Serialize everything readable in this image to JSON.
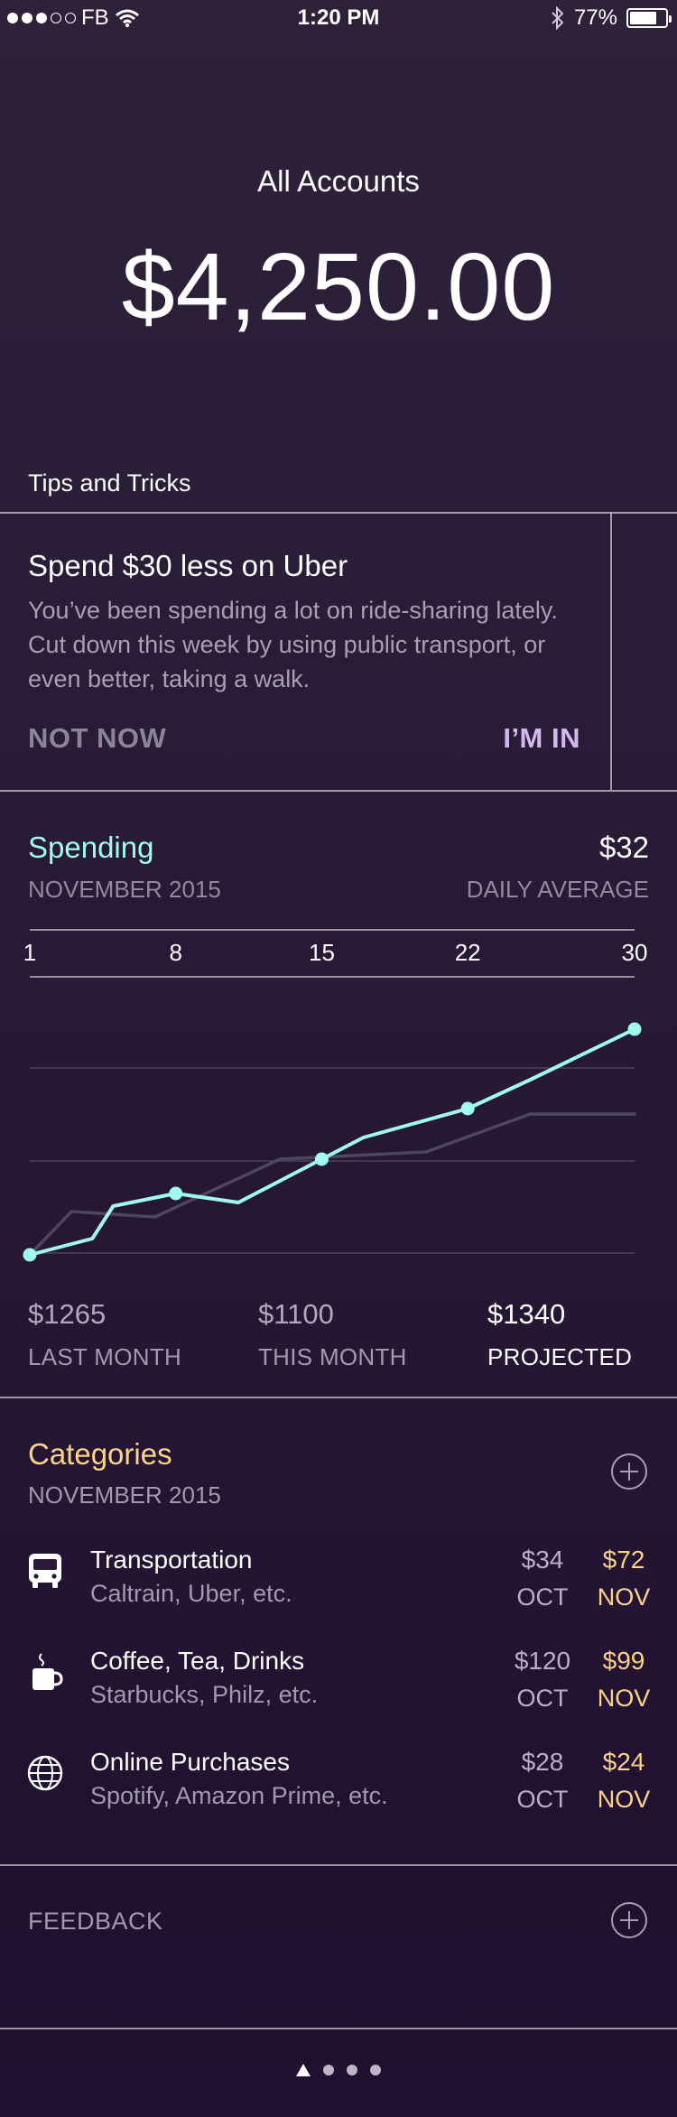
{
  "status_bar": {
    "carrier": "FB",
    "time": "1:20 PM",
    "battery": "77%",
    "battery_level": 0.77,
    "signal_bars_filled": 3,
    "signal_bars_total": 5
  },
  "header": {
    "title": "All Accounts",
    "balance": "$4,250.00"
  },
  "tips": {
    "section_label": "Tips and Tricks",
    "card": {
      "title": "Spend $30 less on Uber",
      "body": "You’ve been spending a lot on ride-sharing lately. Cut down this week by using public transport, or even better, taking a walk.",
      "dismiss_label": "NOT NOW",
      "accept_label": "I’M IN"
    }
  },
  "spending": {
    "title": "Spending",
    "period": "NOVEMBER 2015",
    "daily_average_value": "$32",
    "daily_average_label": "DAILY AVERAGE",
    "stats": [
      {
        "value": "$1265",
        "label": "LAST MONTH"
      },
      {
        "value": "$1100",
        "label": "THIS MONTH"
      },
      {
        "value": "$1340",
        "label": "PROJECTED"
      }
    ]
  },
  "chart_data": {
    "type": "line",
    "x_ticks": [
      "1",
      "8",
      "15",
      "22",
      "30"
    ],
    "xlim": [
      1,
      30
    ],
    "ylim": [
      0,
      1400
    ],
    "grid": true,
    "series": [
      {
        "name": "",
        "color": "#a0fbec",
        "x": [
          1,
          4,
          5,
          8,
          11,
          15,
          17,
          22,
          25,
          30
        ],
        "y": [
          0,
          90,
          270,
          340,
          290,
          530,
          650,
          810,
          970,
          1250
        ],
        "markers_at": [
          1,
          8,
          15,
          22,
          30
        ]
      },
      {
        "name": "",
        "color": "#4c4663",
        "x": [
          1,
          3,
          7,
          13,
          20,
          25,
          30
        ],
        "y": [
          0,
          240,
          210,
          530,
          570,
          780,
          780
        ],
        "markers_at": []
      }
    ]
  },
  "categories": {
    "title": "Categories",
    "period": "NOVEMBER 2015",
    "items": [
      {
        "icon": "bus-icon",
        "name": "Transportation",
        "desc": "Caltrain, Uber, etc.",
        "oct_value": "$34",
        "oct_label": "OCT",
        "nov_value": "$72",
        "nov_label": "NOV"
      },
      {
        "icon": "coffee-icon",
        "name": "Coffee, Tea, Drinks",
        "desc": "Starbucks, Philz, etc.",
        "oct_value": "$120",
        "oct_label": "OCT",
        "nov_value": "$99",
        "nov_label": "NOV"
      },
      {
        "icon": "globe-icon",
        "name": "Online Purchases",
        "desc": "Spotify, Amazon Prime, etc.",
        "oct_value": "$28",
        "oct_label": "OCT",
        "nov_value": "$24",
        "nov_label": "NOV"
      }
    ]
  },
  "feedback": {
    "label": "FEEDBACK"
  },
  "pager": {
    "pages": 4,
    "current": 1
  },
  "colors": {
    "accent_mint": "#a0fbec",
    "accent_gold": "#fdd28a",
    "accent_lavender": "#d6b8f1"
  }
}
